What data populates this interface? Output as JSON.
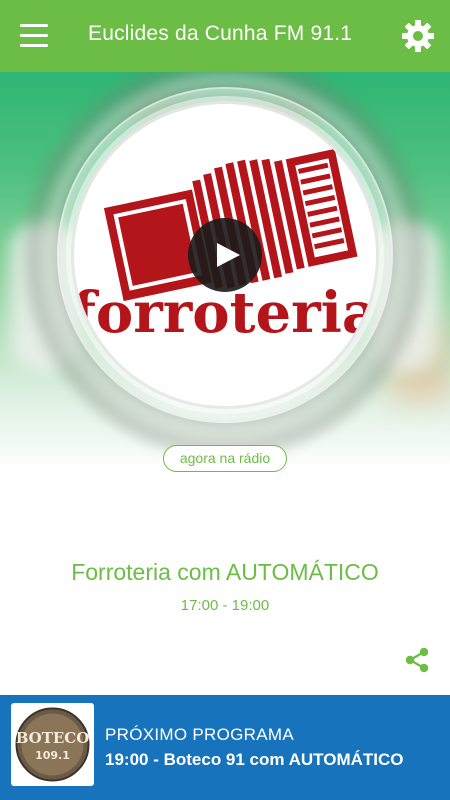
{
  "header": {
    "title": "Euclides da Cunha FM 91.1",
    "menu_icon": "menu-icon",
    "settings_icon": "gear-icon"
  },
  "player": {
    "cover_logo_text": "forroteria",
    "play_icon": "play-icon",
    "now_badge": "agora na rádio"
  },
  "current_program": {
    "title": "Forroteria com AUTOMÁTICO",
    "time": "17:00 - 19:00",
    "share_icon": "share-icon"
  },
  "next_program": {
    "label": "PRÓXIMO PROGRAMA",
    "title": "19:00 - Boteco 91 com AUTOMÁTICO",
    "thumb_logo_text": "BOTECO",
    "thumb_logo_sub": "109.1"
  },
  "colors": {
    "brand_green": "#6cbd45",
    "bottom_blue": "#1873bd",
    "accordion_red": "#b3151b"
  }
}
